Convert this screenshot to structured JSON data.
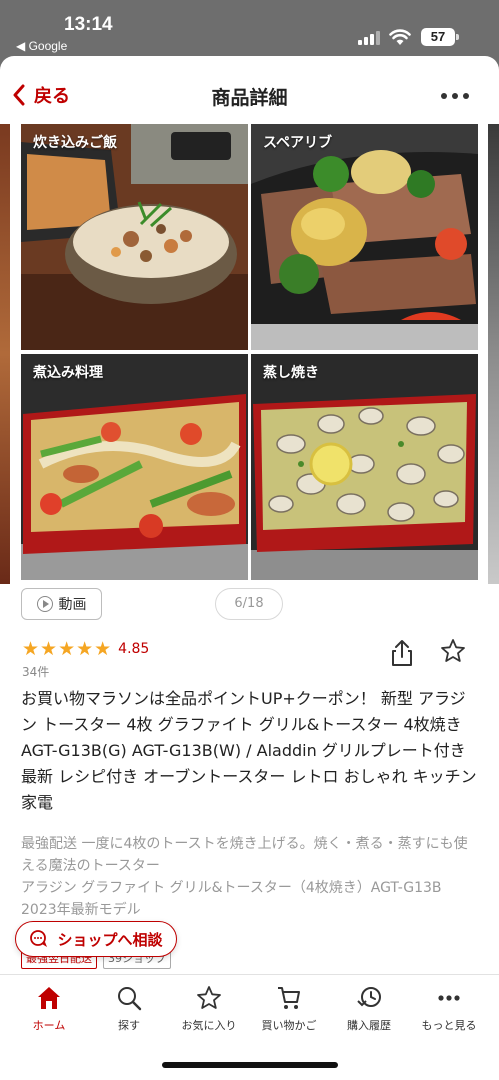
{
  "status_bar": {
    "time": "13:14",
    "back_app": "◀ Google",
    "battery": "57"
  },
  "nav": {
    "back_label": "戻る",
    "title": "商品詳細"
  },
  "gallery": {
    "tiles": [
      {
        "label": "炊き込みご飯"
      },
      {
        "label": "スペアリブ"
      },
      {
        "label": "煮込み料理"
      },
      {
        "label": "蒸し焼き"
      }
    ],
    "video_label": "動画",
    "counter": "6/18"
  },
  "rating": {
    "stars": "★★★★★",
    "value": "4.85",
    "reviews": "34件"
  },
  "product": {
    "title": "お買い物マラソンは全品ポイントUP+クーポン！ 新型 アラジン トースター 4枚 グラファイト グリル&トースター 4枚焼き AGT-G13B(G) AGT-G13B(W) / Aladdin グリルプレート付き 最新 レシピ付き オーブントースター レトロ おしゃれ キッチン家電",
    "description": "最強配送 一度に4枚のトーストを焼き上げる。焼く・煮る・蒸すにも使える魔法のトースター\nアラジン グラファイト グリル&トースター（4枚焼き）AGT-G13B  2023年最新モデル"
  },
  "tags": [
    "最強翌日配送",
    "39ショップ"
  ],
  "consult_label": "ショップへ相談",
  "tabs": [
    {
      "label": "ホーム",
      "icon": "home-icon"
    },
    {
      "label": "探す",
      "icon": "search-icon"
    },
    {
      "label": "お気に入り",
      "icon": "star-icon"
    },
    {
      "label": "買い物かご",
      "icon": "cart-icon"
    },
    {
      "label": "購入履歴",
      "icon": "history-icon"
    },
    {
      "label": "もっと見る",
      "icon": "more-icon"
    }
  ],
  "colors": {
    "accent": "#bf0000",
    "star": "#f5a623"
  }
}
